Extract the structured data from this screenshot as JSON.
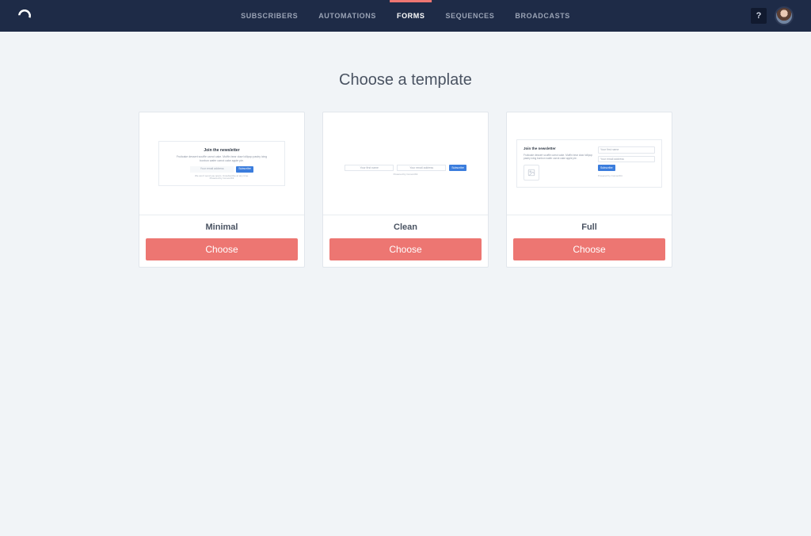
{
  "nav": {
    "items": [
      {
        "label": "SUBSCRIBERS",
        "active": false
      },
      {
        "label": "AUTOMATIONS",
        "active": false
      },
      {
        "label": "FORMS",
        "active": true
      },
      {
        "label": "SEQUENCES",
        "active": false
      },
      {
        "label": "BROADCASTS",
        "active": false
      }
    ],
    "help_label": "?"
  },
  "page": {
    "title": "Choose a template"
  },
  "templates": [
    {
      "name": "Minimal",
      "button": "Choose"
    },
    {
      "name": "Clean",
      "button": "Choose"
    },
    {
      "name": "Full",
      "button": "Choose"
    }
  ],
  "preview_strings": {
    "join_title": "Join the newsletter",
    "lorem1": "Fruitcake dessert souffle carrot cake. Muffin bear claw lollipop pastry icing",
    "lorem2": "bonbon wafer carrot cake apple pie.",
    "your_email": "Your email address",
    "your_name": "Your first name",
    "subscribe": "Subscribe",
    "unsubscribe_hint": "We won't send you spam. Unsubscribe at any time.",
    "powered": "Powered by ConvertKit"
  },
  "colors": {
    "accent": "#ed7672",
    "primary_button": "#3b7ddd",
    "navbar": "#1e2b47",
    "page_bg": "#f1f4f7"
  }
}
